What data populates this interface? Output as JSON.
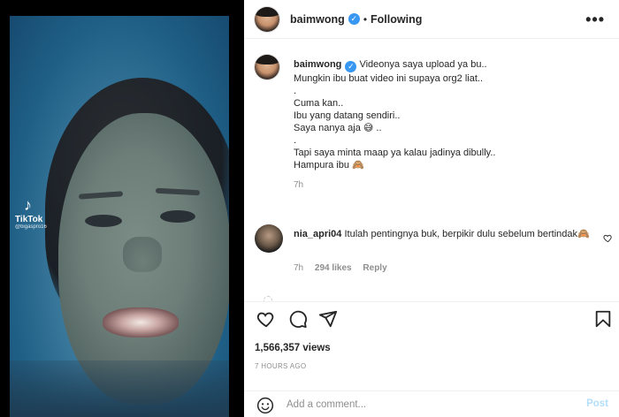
{
  "video": {
    "watermark_brand": "TikTok",
    "watermark_handle": "@bigaspro16"
  },
  "header": {
    "username": "baimwong",
    "separator": "•",
    "follow_status": "Following",
    "more": "•••"
  },
  "caption": {
    "username": "baimwong",
    "lines": [
      "Videonya saya upload ya bu..",
      "Mungkin ibu buat video ini supaya org2 liat..",
      ".",
      "Cuma kan..",
      "Ibu yang datang sendiri..",
      "Saya nanya aja 😅 ..",
      ".",
      "Tapi saya minta maap ya kalau jadinya dibully..",
      "Hampura ibu 🙈"
    ],
    "time": "7h"
  },
  "comment": {
    "username": "nia_apri04",
    "text": "Itulah pentingnya buk, berpikir dulu sebelum bertindak🙈",
    "time": "7h",
    "likes": "294 likes",
    "reply": "Reply"
  },
  "stats": {
    "views": "1,566,357 views",
    "posted": "7 HOURS AGO"
  },
  "add_comment": {
    "placeholder": "Add a comment...",
    "post": "Post"
  },
  "colors": {
    "accent": "#3897f0",
    "post_disabled": "#b2dffc",
    "muted": "#8e8e8e"
  }
}
